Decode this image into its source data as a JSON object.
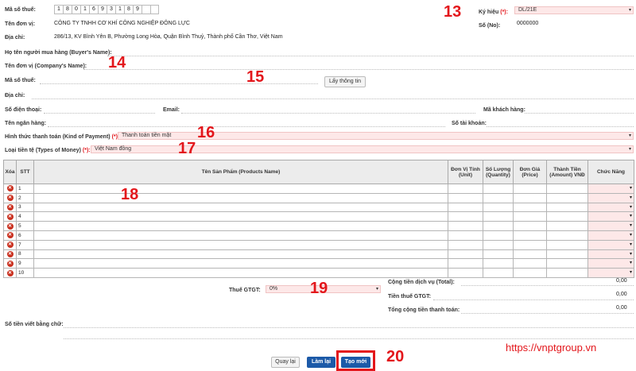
{
  "seller": {
    "tax_label": "Mã số thuế:",
    "tax_digits": [
      "1",
      "8",
      "0",
      "1",
      "6",
      "9",
      "3",
      "1",
      "8",
      "9",
      "",
      ""
    ],
    "unit_label": "Tên đơn vị:",
    "unit_value": "CÔNG TY TNHH CƠ KHÍ CÔNG NGHIỆP ĐÔNG LỰC",
    "address_label": "Địa chỉ:",
    "address_value": "286/13, KV Bình Yên B, Phường Long Hòa, Quận Bình Thuỷ, Thành phố Cần Thơ, Việt Nam"
  },
  "invoice": {
    "symbol_label": "Ký hiệu",
    "required_mark": "(*):",
    "symbol_value": "DL/21E",
    "number_label": "Số (No):",
    "number_value": "0000000"
  },
  "buyer": {
    "buyer_name_label": "Họ tên người mua hàng (Buyer's Name):",
    "company_label": "Tên đơn vị (Company's Name):",
    "tax_label": "Mã số thuế:",
    "fetch_button": "Lấy thông tin",
    "address_label": "Địa chỉ:",
    "phone_label": "Số điện thoại:",
    "email_label": "Email:",
    "customer_code_label": "Mã khách hàng:",
    "bank_label": "Tên ngân hàng:",
    "account_label": "Số tài khoản:",
    "payment_label": "Hình thức thanh toán (Kind of Payment)",
    "payment_value": "Thanh toán tiền mặt",
    "currency_label": "Loại tiền tệ (Types of Money)",
    "currency_value": "Việt Nam đồng"
  },
  "table": {
    "headers": {
      "delete": "Xóa",
      "stt": "STT",
      "product": "Tên Sản Phẩm (Products Name)",
      "unit": "Đơn Vị Tính (Unit)",
      "quantity": "Số Lượng (Quantity)",
      "price": "Đơn Giá (Price)",
      "amount": "Thành Tiền (Amount) VNĐ",
      "function": "Chức Năng"
    },
    "rows": [
      "1",
      "2",
      "3",
      "4",
      "5",
      "6",
      "7",
      "8",
      "9",
      "10"
    ]
  },
  "totals": {
    "vat_label": "Thuế GTGT:",
    "vat_value": "0%",
    "service_total_label": "Cộng tiền dịch vụ (Total):",
    "service_total_value": "0,00",
    "vat_amount_label": "Tiền thuế GTGT:",
    "vat_amount_value": "0,00",
    "grand_total_label": "Tổng cộng tiền thanh toán:",
    "grand_total_value": "0,00",
    "words_label": "Số tiền viết bằng chữ:"
  },
  "buttons": {
    "back": "Quay lại",
    "reset": "Làm lại",
    "create": "Tạo mới"
  },
  "annotations": {
    "n13": "13",
    "n14": "14",
    "n15": "15",
    "n16": "16",
    "n17": "17",
    "n18": "18",
    "n19": "19",
    "n20": "20"
  },
  "watermark": "https://vnptgroup.vn",
  "colors": {
    "annotation": "#e3161b",
    "required": "#e3161b",
    "select_bg": "#fde8e8",
    "primary_button": "#1c5aa8",
    "delete_icon": "#c9301f"
  }
}
